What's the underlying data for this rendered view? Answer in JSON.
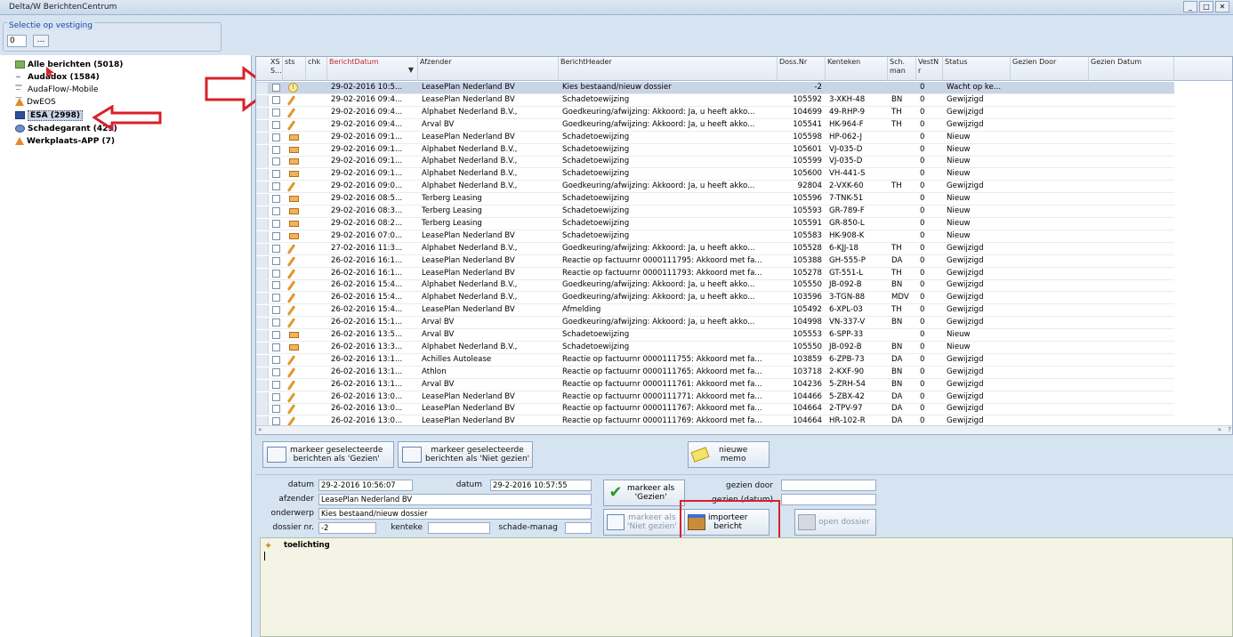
{
  "window": {
    "title": "Delta/W BerichtenCentrum",
    "buttons": [
      "_",
      "□",
      "✕"
    ]
  },
  "vestiging": {
    "label": "Selectie op vestiging",
    "value": "0",
    "browse_label": "..."
  },
  "tree": {
    "items": [
      {
        "label": "Alle berichten (5018)",
        "icon": "mail-icon"
      },
      {
        "label": "Audadox (1584)",
        "icon": "signal-icon"
      },
      {
        "label": "AudaFlow/-Mobile",
        "icon": "signal-icon"
      },
      {
        "label": "DwEOS",
        "icon": "triangle-icon"
      },
      {
        "label": "ESA (2998)",
        "icon": "esa-icon"
      },
      {
        "label": "Schadegarant (429)",
        "icon": "globe-icon"
      },
      {
        "label": "Werkplaats-APP (7)",
        "icon": "triangle-icon"
      }
    ]
  },
  "grid": {
    "columns": [
      "XS S...",
      "sts",
      "chk",
      "BerichtDatum",
      "Afzender",
      "BerichtHeader",
      "Doss.Nr",
      "Kenteken",
      "Sch. man",
      "VestN r",
      "Status",
      "Gezien Door",
      "Gezien Datum"
    ],
    "rows": [
      {
        "sts": "info",
        "datum": "29-02-2016 10:5...",
        "afzender": "LeasePlan Nederland BV",
        "header": "Kies bestaand/nieuw dossier",
        "doss": "-2",
        "kenteken": "",
        "sch": "",
        "vest": "0",
        "status": "Wacht op ke..."
      },
      {
        "sts": "pen",
        "datum": "29-02-2016 09:4...",
        "afzender": "LeasePlan Nederland BV",
        "header": "Schadetoewijzing",
        "doss": "105592",
        "kenteken": "3-XKH-48",
        "sch": "BN",
        "vest": "0",
        "status": "Gewijzigd"
      },
      {
        "sts": "pen",
        "datum": "29-02-2016 09:4...",
        "afzender": "Alphabet Nederland B.V.,",
        "header": "Goedkeuring/afwijzing: Akkoord: Ja, u heeft akko...",
        "doss": "104699",
        "kenteken": "49-RHP-9",
        "sch": "TH",
        "vest": "0",
        "status": "Gewijzigd"
      },
      {
        "sts": "pen",
        "datum": "29-02-2016 09:4...",
        "afzender": "Arval BV",
        "header": "Goedkeuring/afwijzing: Akkoord: Ja, u heeft akko...",
        "doss": "105541",
        "kenteken": "HK-964-F",
        "sch": "TH",
        "vest": "0",
        "status": "Gewijzigd"
      },
      {
        "sts": "env",
        "datum": "29-02-2016 09:1...",
        "afzender": "LeasePlan Nederland BV",
        "header": "Schadetoewijzing",
        "doss": "105598",
        "kenteken": "HP-062-J",
        "sch": "",
        "vest": "0",
        "status": "Nieuw"
      },
      {
        "sts": "env",
        "datum": "29-02-2016 09:1...",
        "afzender": "Alphabet Nederland B.V.,",
        "header": "Schadetoewijzing",
        "doss": "105601",
        "kenteken": "VJ-035-D",
        "sch": "",
        "vest": "0",
        "status": "Nieuw"
      },
      {
        "sts": "env",
        "datum": "29-02-2016 09:1...",
        "afzender": "Alphabet Nederland B.V.,",
        "header": "Schadetoewijzing",
        "doss": "105599",
        "kenteken": "VJ-035-D",
        "sch": "",
        "vest": "0",
        "status": "Nieuw"
      },
      {
        "sts": "env",
        "datum": "29-02-2016 09:1...",
        "afzender": "Alphabet Nederland B.V.,",
        "header": "Schadetoewijzing",
        "doss": "105600",
        "kenteken": "VH-441-S",
        "sch": "",
        "vest": "0",
        "status": "Nieuw"
      },
      {
        "sts": "pen",
        "datum": "29-02-2016 09:0...",
        "afzender": "Alphabet Nederland B.V.,",
        "header": "Goedkeuring/afwijzing: Akkoord: Ja, u heeft akko...",
        "doss": "92804",
        "kenteken": "2-VXK-60",
        "sch": "TH",
        "vest": "0",
        "status": "Gewijzigd"
      },
      {
        "sts": "env",
        "datum": "29-02-2016 08:5...",
        "afzender": "Terberg Leasing",
        "header": "Schadetoewijzing",
        "doss": "105596",
        "kenteken": "7-TNK-51",
        "sch": "",
        "vest": "0",
        "status": "Nieuw"
      },
      {
        "sts": "env",
        "datum": "29-02-2016 08:3...",
        "afzender": "Terberg Leasing",
        "header": "Schadetoewijzing",
        "doss": "105593",
        "kenteken": "GR-789-F",
        "sch": "",
        "vest": "0",
        "status": "Nieuw"
      },
      {
        "sts": "env",
        "datum": "29-02-2016 08:2...",
        "afzender": "Terberg Leasing",
        "header": "Schadetoewijzing",
        "doss": "105591",
        "kenteken": "GR-850-L",
        "sch": "",
        "vest": "0",
        "status": "Nieuw"
      },
      {
        "sts": "env",
        "datum": "29-02-2016 07:0...",
        "afzender": "LeasePlan Nederland BV",
        "header": "Schadetoewijzing",
        "doss": "105583",
        "kenteken": "HK-908-K",
        "sch": "",
        "vest": "0",
        "status": "Nieuw"
      },
      {
        "sts": "pen",
        "datum": "27-02-2016 11:3...",
        "afzender": "Alphabet Nederland B.V.,",
        "header": "Goedkeuring/afwijzing: Akkoord: Ja, u heeft akko...",
        "doss": "105528",
        "kenteken": "6-KJJ-18",
        "sch": "TH",
        "vest": "0",
        "status": "Gewijzigd"
      },
      {
        "sts": "pen",
        "datum": "26-02-2016 16:1...",
        "afzender": "LeasePlan Nederland BV",
        "header": "Reactie op factuurnr 0000111795: Akkoord met fa...",
        "doss": "105388",
        "kenteken": "GH-555-P",
        "sch": "DA",
        "vest": "0",
        "status": "Gewijzigd"
      },
      {
        "sts": "pen",
        "datum": "26-02-2016 16:1...",
        "afzender": "LeasePlan Nederland BV",
        "header": "Reactie op factuurnr 0000111793: Akkoord met fa...",
        "doss": "105278",
        "kenteken": "GT-551-L",
        "sch": "TH",
        "vest": "0",
        "status": "Gewijzigd"
      },
      {
        "sts": "pen",
        "datum": "26-02-2016 15:4...",
        "afzender": "Alphabet Nederland B.V.,",
        "header": "Goedkeuring/afwijzing: Akkoord: Ja, u heeft akko...",
        "doss": "105550",
        "kenteken": "JB-092-B",
        "sch": "BN",
        "vest": "0",
        "status": "Gewijzigd"
      },
      {
        "sts": "pen",
        "datum": "26-02-2016 15:4...",
        "afzender": "Alphabet Nederland B.V.,",
        "header": "Goedkeuring/afwijzing: Akkoord: Ja, u heeft akko...",
        "doss": "103596",
        "kenteken": "3-TGN-88",
        "sch": "MDV",
        "vest": "0",
        "status": "Gewijzigd"
      },
      {
        "sts": "pen",
        "datum": "26-02-2016 15:4...",
        "afzender": "LeasePlan Nederland BV",
        "header": "Afmelding",
        "doss": "105492",
        "kenteken": "6-XPL-03",
        "sch": "TH",
        "vest": "0",
        "status": "Gewijzigd"
      },
      {
        "sts": "pen",
        "datum": "26-02-2016 15:1...",
        "afzender": "Arval BV",
        "header": "Goedkeuring/afwijzing: Akkoord: Ja, u heeft akko...",
        "doss": "104998",
        "kenteken": "VN-337-V",
        "sch": "BN",
        "vest": "0",
        "status": "Gewijzigd"
      },
      {
        "sts": "env",
        "datum": "26-02-2016 13:5...",
        "afzender": "Arval BV",
        "header": "Schadetoewijzing",
        "doss": "105553",
        "kenteken": "6-SPP-33",
        "sch": "",
        "vest": "0",
        "status": "Nieuw"
      },
      {
        "sts": "env",
        "datum": "26-02-2016 13:3...",
        "afzender": "Alphabet Nederland B.V.,",
        "header": "Schadetoewijzing",
        "doss": "105550",
        "kenteken": "JB-092-B",
        "sch": "BN",
        "vest": "0",
        "status": "Nieuw"
      },
      {
        "sts": "pen",
        "datum": "26-02-2016 13:1...",
        "afzender": "Achilles Autolease",
        "header": "Reactie op factuurnr 0000111755: Akkoord met fa...",
        "doss": "103859",
        "kenteken": "6-ZPB-73",
        "sch": "DA",
        "vest": "0",
        "status": "Gewijzigd"
      },
      {
        "sts": "pen",
        "datum": "26-02-2016 13:1...",
        "afzender": "Athlon",
        "header": "Reactie op factuurnr 0000111765: Akkoord met fa...",
        "doss": "103718",
        "kenteken": "2-KXF-90",
        "sch": "BN",
        "vest": "0",
        "status": "Gewijzigd"
      },
      {
        "sts": "pen",
        "datum": "26-02-2016 13:1...",
        "afzender": "Arval BV",
        "header": "Reactie op factuurnr 0000111761: Akkoord met fa...",
        "doss": "104236",
        "kenteken": "5-ZRH-54",
        "sch": "BN",
        "vest": "0",
        "status": "Gewijzigd"
      },
      {
        "sts": "pen",
        "datum": "26-02-2016 13:0...",
        "afzender": "LeasePlan Nederland BV",
        "header": "Reactie op factuurnr 0000111771: Akkoord met fa...",
        "doss": "104466",
        "kenteken": "5-ZBX-42",
        "sch": "DA",
        "vest": "0",
        "status": "Gewijzigd"
      },
      {
        "sts": "pen",
        "datum": "26-02-2016 13:0...",
        "afzender": "LeasePlan Nederland BV",
        "header": "Reactie op factuurnr 0000111767: Akkoord met fa...",
        "doss": "104664",
        "kenteken": "2-TPV-97",
        "sch": "DA",
        "vest": "0",
        "status": "Gewijzigd"
      },
      {
        "sts": "pen",
        "datum": "26-02-2016 13:0...",
        "afzender": "LeasePlan Nederland BV",
        "header": "Reactie op factuurnr 0000111769: Akkoord met fa...",
        "doss": "104664",
        "kenteken": "HR-102-R",
        "sch": "DA",
        "vest": "0",
        "status": "Gewijzigd"
      }
    ]
  },
  "actions": {
    "mark_seen": "markeer geselecteerde\nberichten als 'Gezien'",
    "mark_unseen": "markeer geselecteerde\nberichten als 'Niet gezien'",
    "new_memo": "nieuwe\nmemo"
  },
  "detail": {
    "datum1_label": "datum",
    "datum1_value": "29-2-2016 10:56:07",
    "datum2_label": "datum",
    "datum2_value": "29-2-2016 10:57:55",
    "afzender_label": "afzender",
    "afzender_value": "LeasePlan Nederland BV",
    "onderwerp_label": "onderwerp",
    "onderwerp_value": "Kies bestaand/nieuw dossier",
    "dossier_label": "dossier nr.",
    "dossier_value": "-2",
    "kenteke_label": "kenteke",
    "kenteke_value": "",
    "schade_label": "schade-manag",
    "schade_value": "",
    "gezien_door_label": "gezien door",
    "gezien_door_value": "",
    "gezien_datum_label": "gezien (datum)",
    "gezien_datum_value": "",
    "btn_markeer_gezien": "markeer als\n'Gezien'",
    "btn_markeer_niet": "markeer als\n'Niet gezien'",
    "btn_importeer": "importeer\nbericht",
    "btn_open": "open dossier"
  },
  "memo": {
    "label": "toelichting"
  },
  "colors": {
    "highlight": "#d8202a",
    "selection": "#c9d5e5"
  }
}
